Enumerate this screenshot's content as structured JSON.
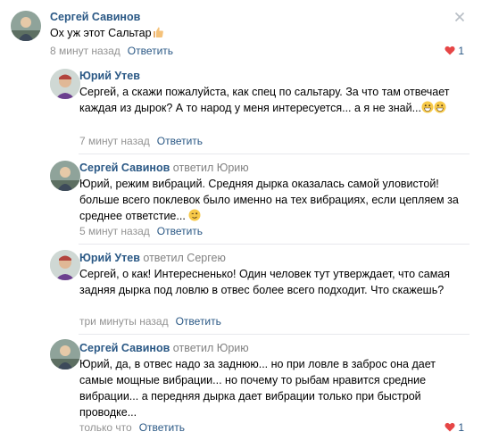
{
  "comments": [
    {
      "author": "Сергей Савинов",
      "reply_to": "",
      "text": "Ох уж этот Сальтар",
      "time": "8 минут назад",
      "reply_label": "Ответить",
      "likes": "1"
    },
    {
      "author": "Юрий Утев",
      "reply_to": "",
      "text": "Сергей, а скажи пожалуйста, как спец по сальтару. За что там отвечает каждая из дырок? А то народ у меня интересуется... а я не знай...",
      "time": "7 минут назад",
      "reply_label": "Ответить"
    },
    {
      "author": "Сергей Савинов",
      "reply_to": "ответил Юрию",
      "text": "Юрий, режим вибраций. Средняя дырка оказалась самой уловистой! больше всего поклевок было именно на тех вибрациях, если цепляем за среднее ответстие...",
      "time": "5 минут назад",
      "reply_label": "Ответить"
    },
    {
      "author": "Юрий Утев",
      "reply_to": "ответил Сергею",
      "text": "Сергей, о как! Интересненько! Один человек тут утверждает, что самая задняя дырка под ловлю в отвес более всего подходит. Что скажешь?",
      "time": "три минуты назад",
      "reply_label": "Ответить"
    },
    {
      "author": "Сергей Савинов",
      "reply_to": "ответил Юрию",
      "text": "Юрий, да, в отвес надо за заднюю... но при ловле в заброс она дает самые мощные вибрации... но почему то рыбам нравится средние вибрации... а передняя дырка дает вибрации только при быстрой проводке...",
      "time": "только что",
      "reply_label": "Ответить",
      "likes": "1"
    }
  ],
  "icons": {
    "close": "close-icon",
    "like": "heart-icon",
    "thumbs_up": "thumbs-up-emoji",
    "grin": "grinning-emoji",
    "wink": "winking-emoji"
  },
  "colors": {
    "link": "#2a5885",
    "meta": "#939393",
    "heart": "#e64646",
    "divider": "#e7e8ec"
  }
}
